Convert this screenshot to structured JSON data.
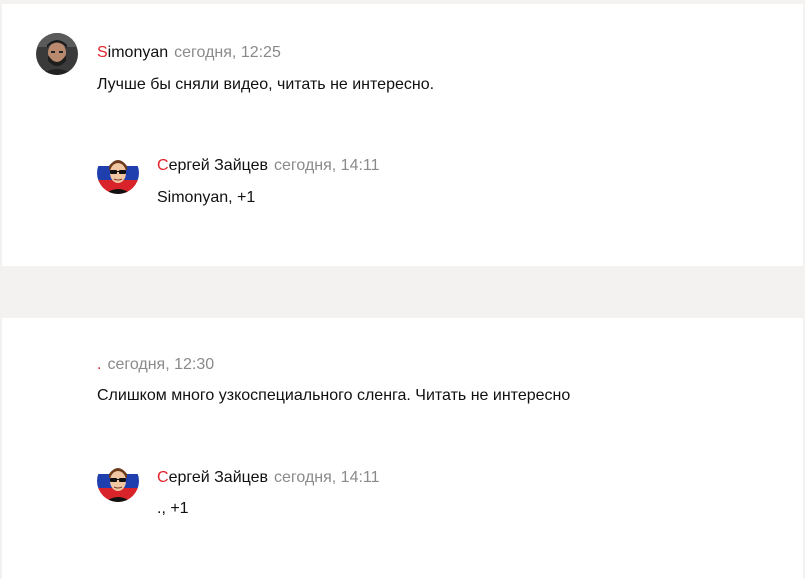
{
  "threads": [
    {
      "root": {
        "author_initial": "S",
        "author_rest": "imonyan",
        "time": "сегодня, 12:25",
        "text": "Лучше бы сняли видео, читать не интересно.",
        "avatar_icon": "bearded-man-avatar-icon"
      },
      "reply": {
        "author_initial": "С",
        "author_rest": "ергей Зайцев",
        "time": "сегодня, 14:11",
        "text": "Simonyan, +1",
        "avatar_icon": "sunglasses-man-russian-flag-avatar-icon"
      }
    },
    {
      "root": {
        "author_initial": ".",
        "author_rest": "",
        "time": "сегодня, 12:30",
        "text": "Слишком много узкоспециального сленга. Читать не интересно"
      },
      "reply": {
        "author_initial": "С",
        "author_rest": "ергей Зайцев",
        "time": "сегодня, 14:11",
        "text": "., +1",
        "avatar_icon": "sunglasses-man-russian-flag-avatar-icon"
      }
    }
  ],
  "colors": {
    "accent_red": "#e0232a",
    "time_gray": "#8a8a8a",
    "page_bg": "#f3f2f0",
    "card_bg": "#ffffff"
  }
}
